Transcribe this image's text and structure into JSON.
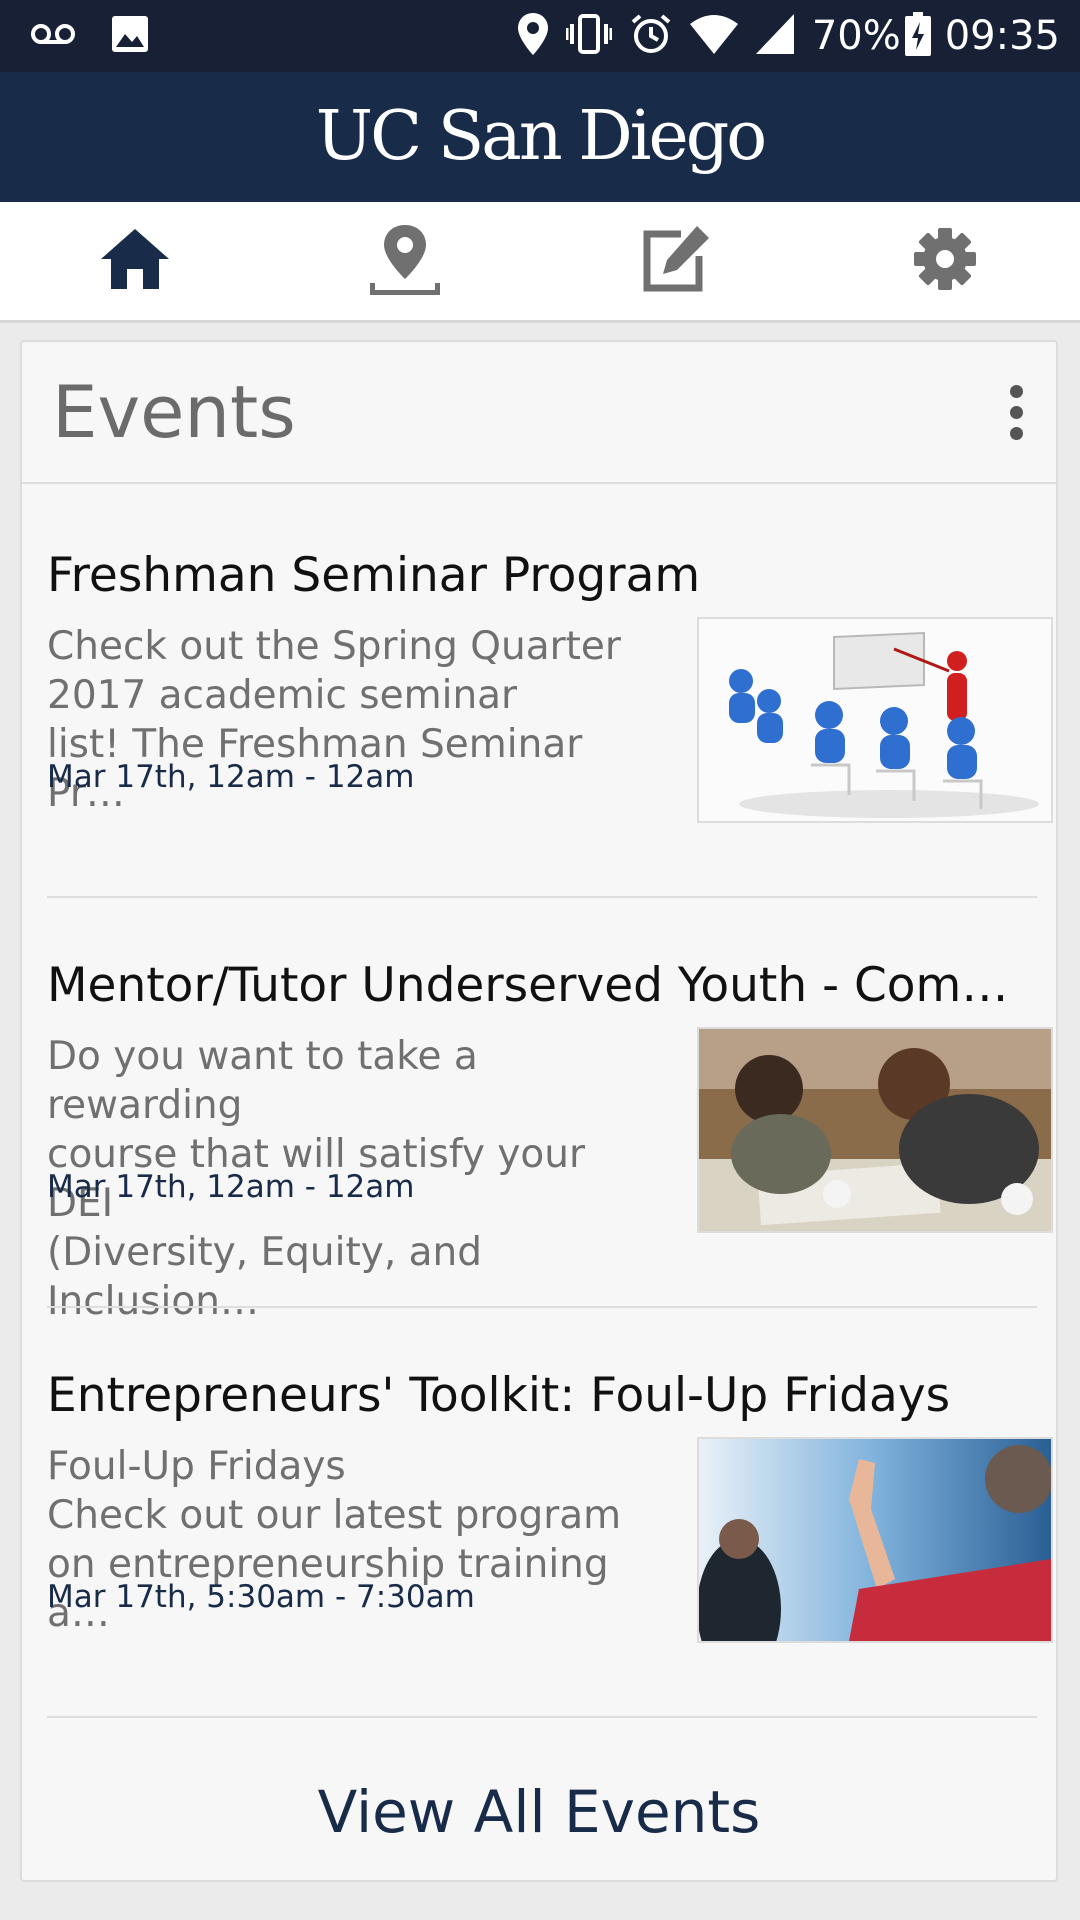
{
  "status_bar": {
    "battery": "70%",
    "time": "09:35",
    "icons": [
      "voicemail-icon",
      "image-icon",
      "location-icon",
      "vibrate-icon",
      "alarm-icon",
      "wifi-icon",
      "signal-icon",
      "battery-charging-icon"
    ]
  },
  "header": {
    "logo_text": "UC San Diego"
  },
  "tabs": [
    {
      "name": "home",
      "icon": "home-icon",
      "active": true
    },
    {
      "name": "map",
      "icon": "map-pin-icon",
      "active": false
    },
    {
      "name": "feedback",
      "icon": "edit-icon",
      "active": false
    },
    {
      "name": "settings",
      "icon": "gear-icon",
      "active": false
    }
  ],
  "card": {
    "title": "Events",
    "more_icon": "more-vertical-icon",
    "view_all_label": "View All Events"
  },
  "events": [
    {
      "title": "Freshman Seminar Program",
      "description": "Check out the Spring Quarter\n2017 academic seminar\nlist! The Freshman Seminar Pr…",
      "date": "Mar 17th, 12am - 12am",
      "image": "classroom-figures-image"
    },
    {
      "title": "Mentor/Tutor Underserved Youth - Comple…",
      "description": "Do you want to take a rewarding\ncourse that will satisfy your DEI\n(Diversity, Equity, and Inclusion…",
      "date": "Mar 17th, 12am - 12am",
      "image": "tutoring-photo"
    },
    {
      "title": "Entrepreneurs' Toolkit: Foul-Up Fridays",
      "description": "Foul-Up Fridays\nCheck out our latest program\non entrepreneurship training a…",
      "date": "Mar 17th, 5:30am - 7:30am",
      "image": "raised-hand-photo"
    }
  ],
  "colors": {
    "brand_navy": "#182b49",
    "status_bar": "#172035",
    "active_tab": "#182b49",
    "inactive_tab": "#707070"
  }
}
